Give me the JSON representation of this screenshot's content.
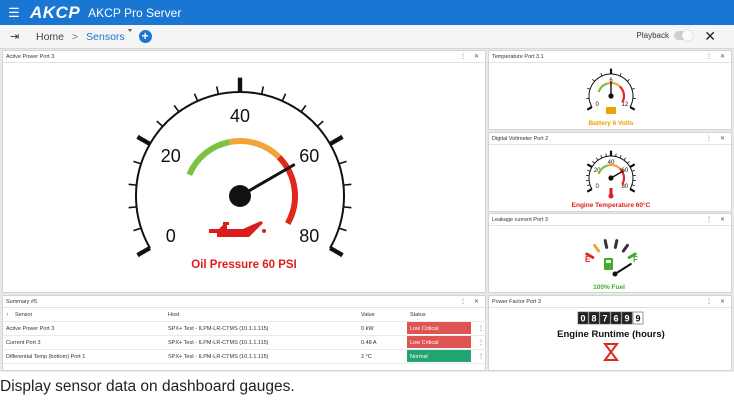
{
  "topbar": {
    "brand": "AKCP",
    "app_name": "AKCP Pro Server",
    "menu_icon": "hamburger-icon"
  },
  "navbar": {
    "home": "Home",
    "separator": ">",
    "sensors": "Sensors",
    "add_icon": "+",
    "playback": "Playback",
    "close": "✕",
    "exit_icon": "exit-icon"
  },
  "panels": {
    "active_power": {
      "title": "Active Power Port 3",
      "gauge_ticks": [
        "0",
        "20",
        "40",
        "60",
        "80"
      ],
      "value": 60,
      "max": 80,
      "reading": "Oil Pressure 60 PSI",
      "reading_color": "#e01b1b",
      "icon": "oil-can-icon"
    },
    "temperature": {
      "title": "Temperature Port 3.1",
      "gauge_ticks": [
        "0",
        "6",
        "12"
      ],
      "value": 6,
      "max": 12,
      "reading": "Battery 6 Volts",
      "reading_color": "#f0a000",
      "icon": "battery-icon"
    },
    "voltmeter": {
      "title": "Digital Voltmeter Port 2",
      "gauge_ticks": [
        "0",
        "20",
        "40",
        "60",
        "80"
      ],
      "value": 60,
      "max": 80,
      "reading": "Engine Temperature 60°C",
      "reading_color": "#e01b1b",
      "icon": "thermometer-icon"
    },
    "leakage": {
      "title": "Leakage current Port 3",
      "empty_label": "E",
      "full_label": "F",
      "value_fraction": 1.0,
      "reading": "100% Fuel",
      "reading_color": "#3fae29",
      "icon": "fuel-pump-icon"
    },
    "power_factor": {
      "title": "Power Factor Port 3",
      "odometer": "087699",
      "reading": "Engine Runtime (hours)",
      "icon": "hourglass-icon"
    },
    "summary": {
      "title": "Summary #5",
      "columns": [
        "Sensor",
        "Host",
        "Value",
        "Status"
      ],
      "rows": [
        {
          "sensor": "Active Power Port 3",
          "host": "SPX+ Test - ILPM-LR-CTMS (10.1.1.115)",
          "value": "0 kW",
          "status": "Low Critical",
          "status_color": "#e05353"
        },
        {
          "sensor": "Current Port 3",
          "host": "SPX+ Test - ILPM-LR-CTMS (10.1.1.115)",
          "value": "0.48 A",
          "status": "Low Critical",
          "status_color": "#e05353"
        },
        {
          "sensor": "Differential Temp (bottom) Port 1",
          "host": "SPX+ Test - ILPM-LR-CTMS (10.1.1.115)",
          "value": "2 °C",
          "status": "Normal",
          "status_color": "#22a36f"
        }
      ]
    }
  },
  "panel_controls": {
    "menu": "⋮",
    "close": "✕"
  },
  "caption": "Display sensor data on dashboard gauges."
}
